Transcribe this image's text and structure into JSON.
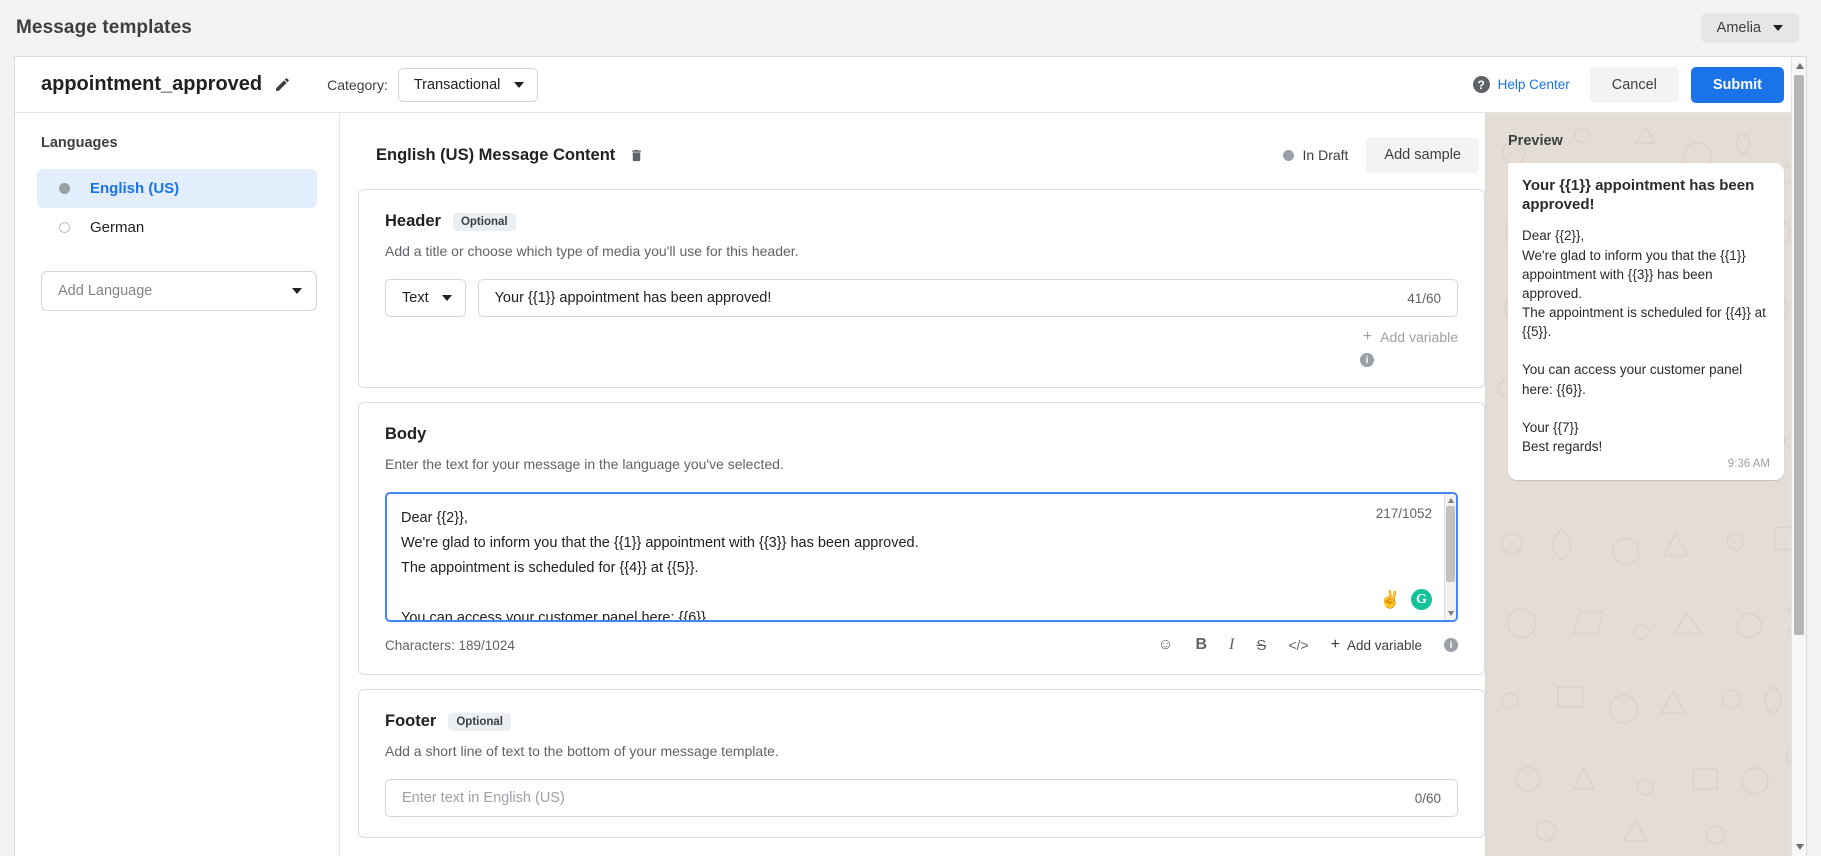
{
  "appbar": {
    "title": "Message templates",
    "user": "Amelia"
  },
  "toolbar": {
    "template_name": "appointment_approved",
    "edit_icon": "pencil-icon",
    "category_label": "Category:",
    "category_value": "Transactional",
    "help_center": "Help Center",
    "help_icon": "question-mark-icon",
    "cancel_label": "Cancel",
    "submit_label": "Submit"
  },
  "sidebar": {
    "heading": "Languages",
    "items": [
      {
        "label": "English (US)",
        "selected": true
      },
      {
        "label": "German",
        "selected": false
      }
    ],
    "add_language_placeholder": "Add Language"
  },
  "content": {
    "title": "English (US) Message Content",
    "delete_icon": "trash-icon",
    "status": "In Draft",
    "add_sample_label": "Add sample"
  },
  "header_section": {
    "title": "Header",
    "optional_chip": "Optional",
    "description": "Add a title or choose which type of media you'll use for this header.",
    "type_value": "Text",
    "value": "Your {{1}} appointment has been approved!",
    "counter": "41/60",
    "add_variable": "Add variable",
    "info_icon": "info-icon"
  },
  "body_section": {
    "title": "Body",
    "description": "Enter the text for your message in the language you've selected.",
    "value": "Dear {{2}},\nWe're glad to inform you that the {{1}} appointment with {{3}} has been approved.\nThe appointment is scheduled for {{4}} at {{5}}.\n\nYou can access your customer panel here: {{6}}.\n\nYour {{7}}",
    "counter": "217/1052",
    "characters_label": "Characters: 189/1024",
    "emoji_badge": "victory-hand-emoji",
    "grammarly_badge": "G",
    "toolbar_icons": [
      {
        "name": "emoji-icon",
        "glyph": "☺"
      },
      {
        "name": "bold-icon",
        "glyph": "B"
      },
      {
        "name": "italic-icon",
        "glyph": "I"
      },
      {
        "name": "strikethrough-icon",
        "glyph": "S"
      },
      {
        "name": "code-icon",
        "glyph": "</>"
      }
    ],
    "add_variable": "Add variable",
    "info_icon": "info-icon"
  },
  "footer_section": {
    "title": "Footer",
    "optional_chip": "Optional",
    "description": "Add a short line of text to the bottom of your message template.",
    "placeholder": "Enter text in English (US)",
    "counter": "0/60"
  },
  "preview": {
    "label": "Preview",
    "bubble_header": "Your {{1}} appointment has been approved!",
    "bubble_body": "Dear {{2}},\nWe're glad to inform you that the {{1}} appointment with {{3}} has been approved.\nThe appointment is scheduled for {{4}} at {{5}}.\n\nYou can access your customer panel here: {{6}}.\n\nYour {{7}}\nBest regards!",
    "time": "9:36 AM"
  },
  "colors": {
    "accent": "#1a73e8",
    "focus_border": "#4285f4",
    "chat_bg": "#e4ddd6",
    "grammarly": "#15c39a"
  }
}
